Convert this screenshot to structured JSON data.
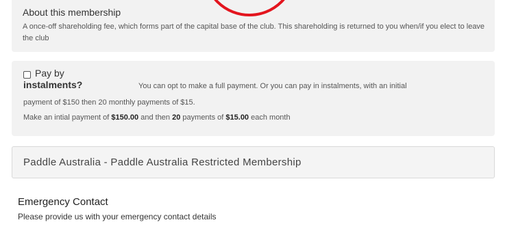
{
  "membership": {
    "about_title": "About this membership",
    "about_text": "A once-off shareholding fee, which forms part of the capital base of the club. This shareholding is returned to you when/if you elect to leave the club"
  },
  "instalments": {
    "checkbox_label_line1": "Pay by",
    "checkbox_label_line2": "instalments?",
    "checked": false,
    "description_line1": "You can opt to make a full payment. Or you can pay in instalments, with an initial",
    "description_line2": "payment of $150 then 20 monthly payments of $15.",
    "summary_prefix": "Make an intial payment of ",
    "initial_amount": "$150.00",
    "summary_mid1": " and then ",
    "payment_count": "20",
    "summary_mid2": " payments of ",
    "monthly_amount": "$15.00",
    "summary_suffix": " each month"
  },
  "paddle": {
    "label": "Paddle Australia - Paddle Australia Restricted Membership"
  },
  "emergency": {
    "title": "Emergency Contact",
    "subtitle": "Please provide us with your emergency contact details"
  },
  "colors": {
    "annotation_circle": "#e3151e",
    "panel_bg": "#f2f2f2"
  }
}
